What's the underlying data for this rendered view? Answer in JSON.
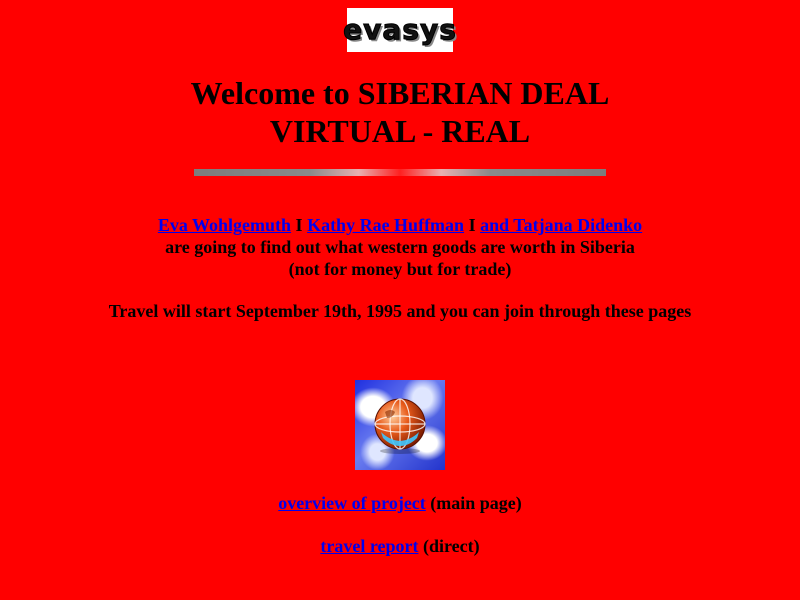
{
  "logo": {
    "text": "evasys"
  },
  "title": {
    "line1": "Welcome to SIBERIAN DEAL",
    "line2": "VIRTUAL - REAL"
  },
  "intro": {
    "links": [
      "Eva Wohlgemuth",
      "Kathy Rae Huffman",
      "and Tatjana Didenko"
    ],
    "separator": "I",
    "line2": "are going to find out what western goods are worth in Siberia",
    "line3": "(not for money but for trade)"
  },
  "travel_note": "Travel will start September 19th, 1995 and you can join through these pages",
  "globe": {
    "icon": "globe-icon"
  },
  "nav": {
    "overview_link": "overview of project",
    "overview_note": "(main page)",
    "travel_link": "travel report",
    "travel_note": "(direct)"
  },
  "colors": {
    "background": "#ff0000",
    "link": "#0000ee"
  }
}
